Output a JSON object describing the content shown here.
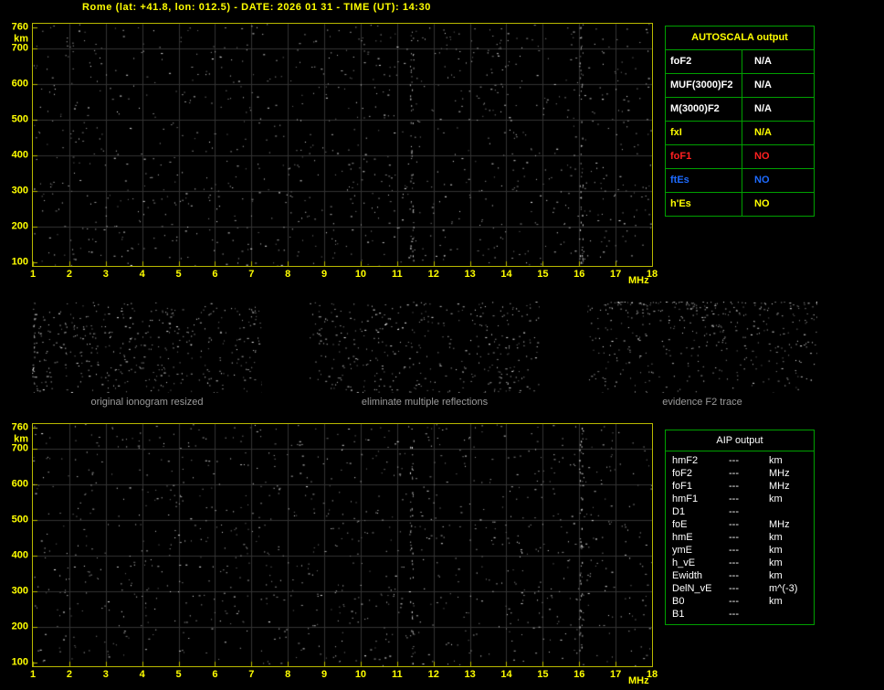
{
  "title": "Rome (lat: +41.8, lon: 012.5) - DATE: 2026 01 31 - TIME (UT): 14:30",
  "colors": {
    "background": "#000000",
    "title": "#ffff00",
    "axis_border": "#b8b800",
    "tick_label": "#ffff00",
    "grid": "#333333",
    "caption": "#9a9a9a",
    "table_border": "#00a000",
    "white": "#ffffff",
    "red": "#ff2020",
    "blue": "#1e6bff",
    "yellow": "#ffff00"
  },
  "ionogram_axes": {
    "x_ticks": [
      "1",
      "2",
      "3",
      "4",
      "5",
      "6",
      "7",
      "8",
      "9",
      "10",
      "11",
      "12",
      "13",
      "14",
      "15",
      "16",
      "17",
      "18"
    ],
    "x_unit": "MHz",
    "y_ticks": [
      "760",
      "700",
      "600",
      "500",
      "400",
      "300",
      "200",
      "100"
    ],
    "y_unit": "km",
    "x_min": 1,
    "x_max": 18,
    "y_min": 100,
    "y_max": 760
  },
  "autoscala_table": {
    "header": "AUTOSCALA output",
    "rows": [
      {
        "label": "foF2",
        "value": "N/A",
        "color": "#ffffff"
      },
      {
        "label": "MUF(3000)F2",
        "value": "N/A",
        "color": "#ffffff"
      },
      {
        "label": "M(3000)F2",
        "value": "N/A",
        "color": "#ffffff"
      },
      {
        "label": "fxI",
        "value": "N/A",
        "color": "#ffff00"
      },
      {
        "label": "foF1",
        "value": "NO",
        "color": "#ff2020"
      },
      {
        "label": "ftEs",
        "value": "NO",
        "color": "#1e6bff"
      },
      {
        "label": "h'Es",
        "value": "NO",
        "color": "#ffff00"
      }
    ]
  },
  "thumbnails": [
    {
      "caption": "original ionogram resized"
    },
    {
      "caption": "eliminate multiple reflections"
    },
    {
      "caption": "evidence F2 trace"
    }
  ],
  "aip_table": {
    "header": "AIP output",
    "rows": [
      {
        "label": "hmF2",
        "value": "---",
        "unit": "km"
      },
      {
        "label": "foF2",
        "value": "---",
        "unit": "MHz"
      },
      {
        "label": "foF1",
        "value": "---",
        "unit": "MHz"
      },
      {
        "label": "hmF1",
        "value": "---",
        "unit": "km"
      },
      {
        "label": "D1",
        "value": "---",
        "unit": ""
      },
      {
        "label": "foE",
        "value": "---",
        "unit": "MHz"
      },
      {
        "label": "hmE",
        "value": "---",
        "unit": "km"
      },
      {
        "label": "ymE",
        "value": "---",
        "unit": "km"
      },
      {
        "label": "h_vE",
        "value": "---",
        "unit": "km"
      },
      {
        "label": "Ewidth",
        "value": "---",
        "unit": "km"
      },
      {
        "label": "DelN_vE",
        "value": "---",
        "unit": "m^(-3)"
      },
      {
        "label": "B0",
        "value": "---",
        "unit": "km"
      },
      {
        "label": "B1",
        "value": "---",
        "unit": ""
      }
    ]
  },
  "chart_data": [
    {
      "type": "scatter",
      "title": "ionogram (top panel)",
      "xlabel": "MHz",
      "ylabel": "km",
      "xlim": [
        1,
        18
      ],
      "ylim": [
        100,
        760
      ],
      "x_ticks": [
        1,
        2,
        3,
        4,
        5,
        6,
        7,
        8,
        9,
        10,
        11,
        12,
        13,
        14,
        15,
        16,
        17,
        18
      ],
      "y_ticks": [
        100,
        200,
        300,
        400,
        500,
        600,
        700,
        760
      ],
      "grid": true,
      "series": [],
      "annotations": [
        "no ionospheric echo trace detected (all scaled parameters N/A); panel shows background noise speckle only"
      ]
    },
    {
      "type": "scatter",
      "title": "ionogram (bottom panel)",
      "xlabel": "MHz",
      "ylabel": "km",
      "xlim": [
        1,
        18
      ],
      "ylim": [
        100,
        760
      ],
      "x_ticks": [
        1,
        2,
        3,
        4,
        5,
        6,
        7,
        8,
        9,
        10,
        11,
        12,
        13,
        14,
        15,
        16,
        17,
        18
      ],
      "y_ticks": [
        100,
        200,
        300,
        400,
        500,
        600,
        700,
        760
      ],
      "grid": true,
      "series": [],
      "annotations": [
        "no ionospheric echo trace detected; panel shows background noise speckle only"
      ]
    }
  ]
}
